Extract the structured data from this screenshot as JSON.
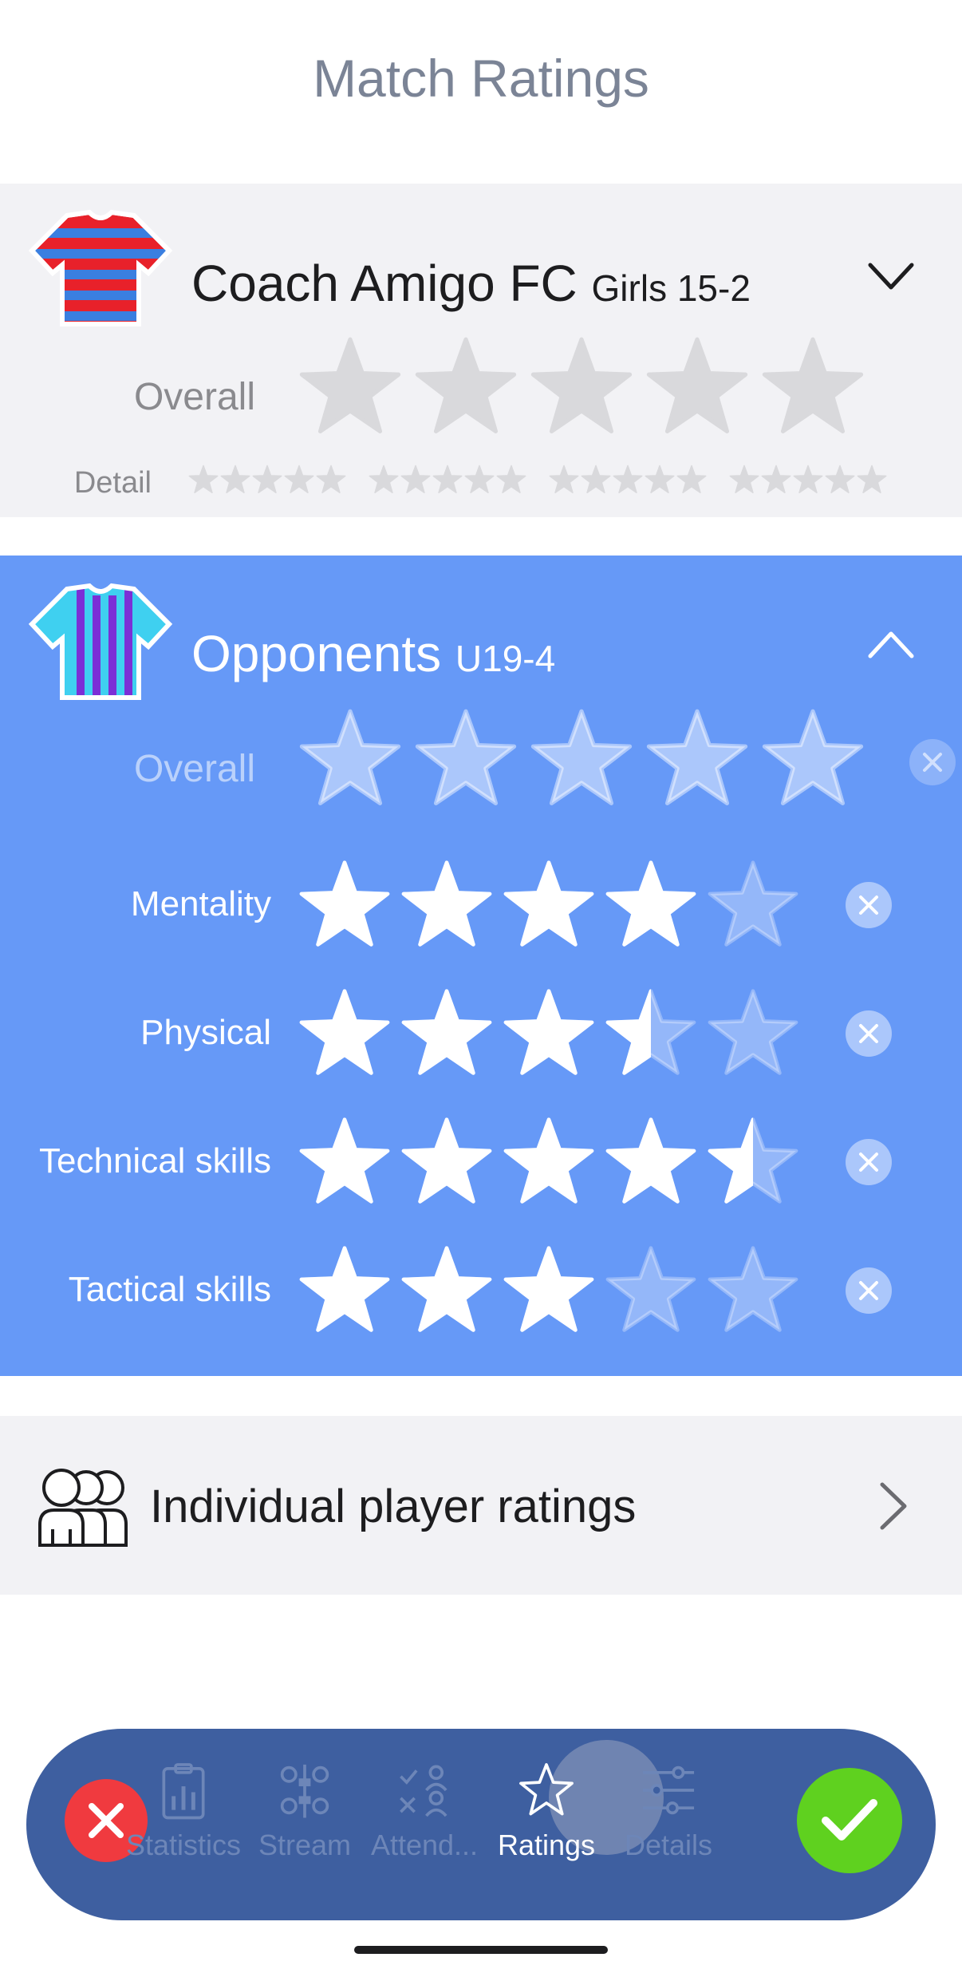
{
  "header": {
    "title": "Match Ratings"
  },
  "team": {
    "name": "Coach Amigo FC",
    "subtitle": "Girls 15-2",
    "overall_label": "Overall",
    "detail_label": "Detail",
    "overall_rating": 0,
    "detail_ratings": [
      0,
      0,
      0,
      0
    ],
    "jersey_colors": {
      "body": "#e8212a",
      "stripe": "#3a7fe0"
    }
  },
  "opponents": {
    "name": "Opponents",
    "subtitle": "U19-4",
    "overall_label": "Overall",
    "overall_rating": 0,
    "jersey_colors": {
      "body": "#3fd0f0",
      "stripe": "#7b2fd6"
    },
    "categories": [
      {
        "label": "Mentality",
        "rating": 4
      },
      {
        "label": "Physical",
        "rating": 3.5
      },
      {
        "label": "Technical skills",
        "rating": 4.5
      },
      {
        "label": "Tactical skills",
        "rating": 3
      }
    ]
  },
  "individual": {
    "label": "Individual player ratings"
  },
  "tabs": [
    {
      "label": "Statistics",
      "icon": "statistics-icon",
      "active": false
    },
    {
      "label": "Stream",
      "icon": "stream-icon",
      "active": false
    },
    {
      "label": "Attend...",
      "icon": "attendance-icon",
      "active": false
    },
    {
      "label": "Ratings",
      "icon": "star-icon",
      "active": true
    },
    {
      "label": "Details",
      "icon": "sliders-icon",
      "active": false
    }
  ],
  "colors": {
    "accent": "#6699f7",
    "tabbar": "#3e5fa0",
    "cancel": "#f03a3f",
    "confirm": "#5fd11f",
    "star_empty_gray": "#d9d9dc"
  }
}
